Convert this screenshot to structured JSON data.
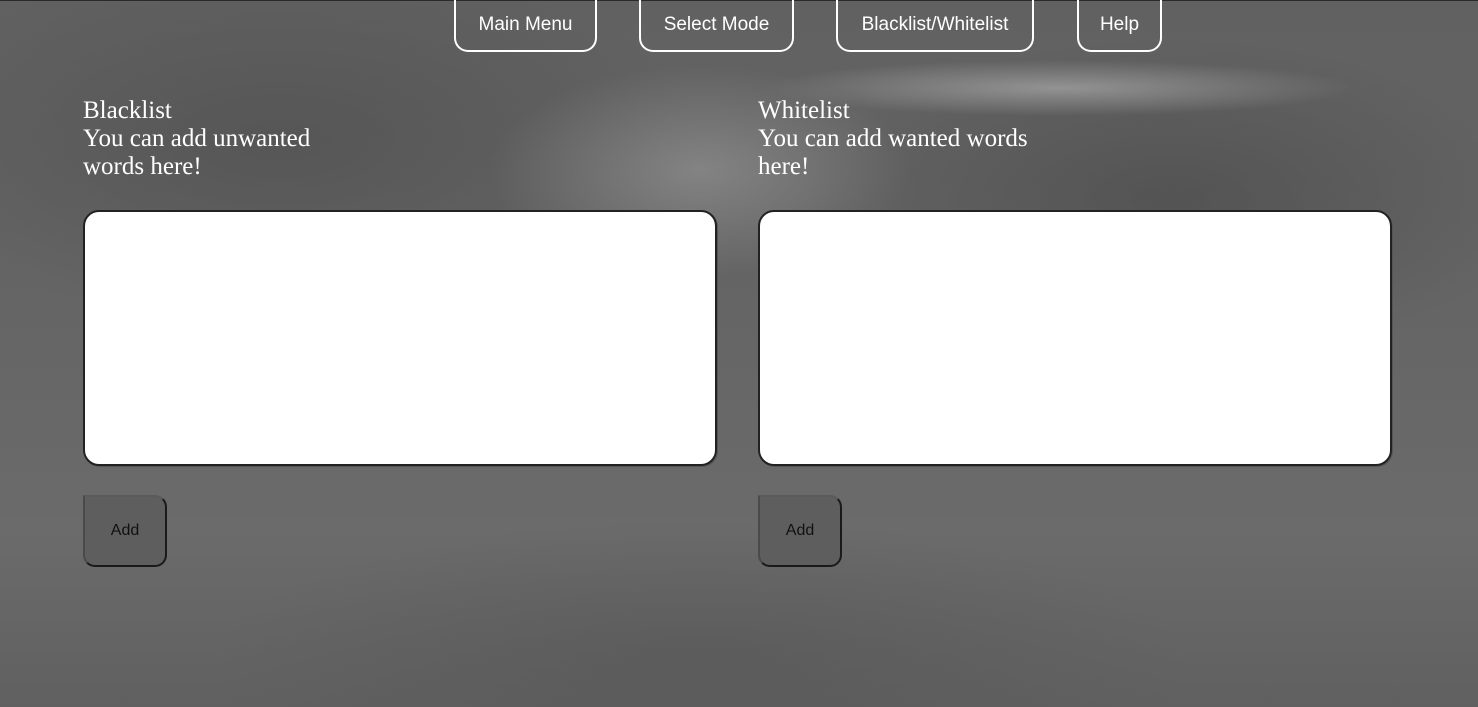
{
  "nav": {
    "main_menu": "Main Menu",
    "select_mode": "Select Mode",
    "blacklist_whitelist": "Blacklist/Whitelist",
    "help": "Help"
  },
  "blacklist": {
    "title": "Blacklist",
    "description": "You can add unwanted words here!",
    "input_value": "",
    "add_label": "Add"
  },
  "whitelist": {
    "title": "Whitelist",
    "description": "You can add wanted words here!",
    "input_value": "",
    "add_label": "Add"
  }
}
